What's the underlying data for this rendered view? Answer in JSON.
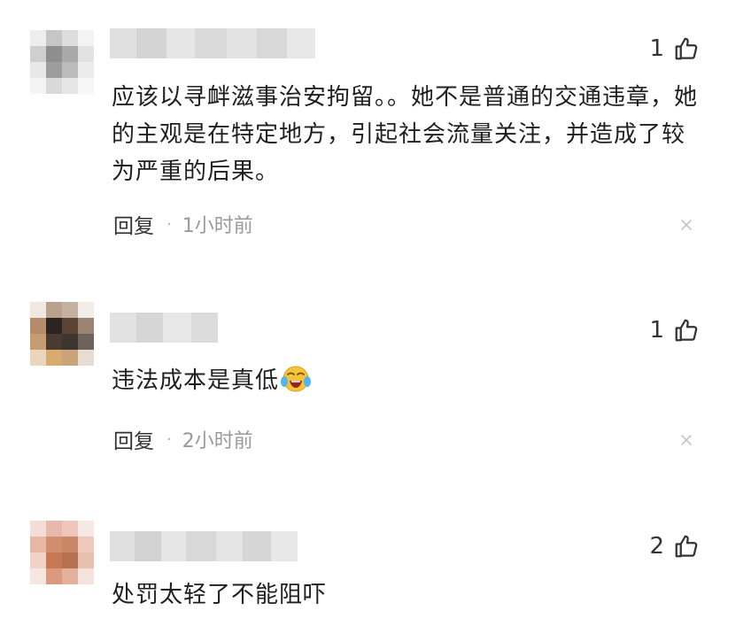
{
  "comments": [
    {
      "likes": "1",
      "text": "应该以寻衅滋事治安拘留。。她不是普通的交通违章，她的主观是在特定地方，引起社会流量关注，并造成了较为严重的后果。",
      "reply_label": "回复",
      "separator": "·",
      "time": "1小时前"
    },
    {
      "likes": "1",
      "text": "违法成本是真低",
      "reply_label": "回复",
      "separator": "·",
      "time": "2小时前"
    },
    {
      "likes": "2",
      "text": "处罚太轻了不能阻吓"
    }
  ],
  "colors": {
    "text": "#1f1f1f",
    "meta": "#9a9a9a",
    "icon": "#333333",
    "close": "#c4c4c4"
  },
  "icons": {
    "like": "thumbs-up-icon",
    "close": "close-icon",
    "emoji": "crying-laughing-emoji-icon"
  }
}
